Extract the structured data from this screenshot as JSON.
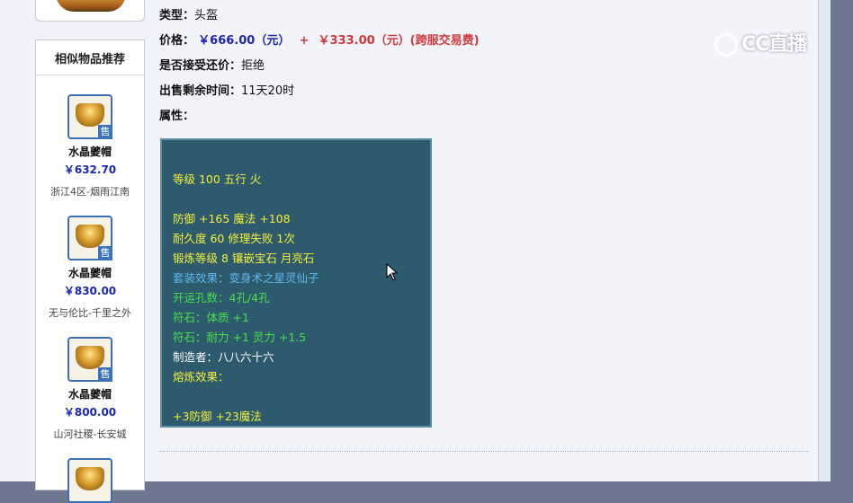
{
  "item": {
    "type_label": "类型：",
    "type_value": "头盔",
    "price_label": "价格：",
    "price_main": "￥666.00（元）",
    "price_plus": "+",
    "price_fee": "￥333.00（元）(跨服交易费)",
    "counter_label": "是否接受还价：",
    "counter_value": "拒绝",
    "remaining_label": "出售剩余时间：",
    "remaining_value": "11天20时",
    "attr_label": "属性："
  },
  "attributes": {
    "line1": "等级 100 五行 火",
    "line2": "防御 +165 魔法 +108",
    "line3": "耐久度 60 修理失败 1次",
    "line4": "锻炼等级 8 镶嵌宝石 月亮石",
    "line5": "套装效果：变身术之星灵仙子",
    "line6": "开运孔数：4孔/4孔",
    "line7": "符石：体质 +1",
    "line8": "符石：耐力 +1 灵力 +1.5",
    "line9": "制造者：八八六十六",
    "line10": "熔炼效果：",
    "line11": "+3防御 +23魔法"
  },
  "sidebar": {
    "title": "相似物品推荐",
    "sale_tag": "售",
    "items": [
      {
        "name": "水晶夔帽",
        "price": "￥632.70",
        "server": "浙江4区-烟雨江南"
      },
      {
        "name": "水晶夔帽",
        "price": "￥830.00",
        "server": "无与伦比-千里之外"
      },
      {
        "name": "水晶夔帽",
        "price": "￥800.00",
        "server": "山河社稷-长安城"
      }
    ]
  },
  "watermark": {
    "text": "CC直播"
  },
  "colors": {
    "price_blue": "#1c27b4",
    "price_red": "#d23a3a",
    "attr_box_bg": "#2d5a6d",
    "attr_yellow": "#f2ef3a",
    "attr_blue": "#5fb7ea",
    "attr_green": "#45e04a"
  }
}
